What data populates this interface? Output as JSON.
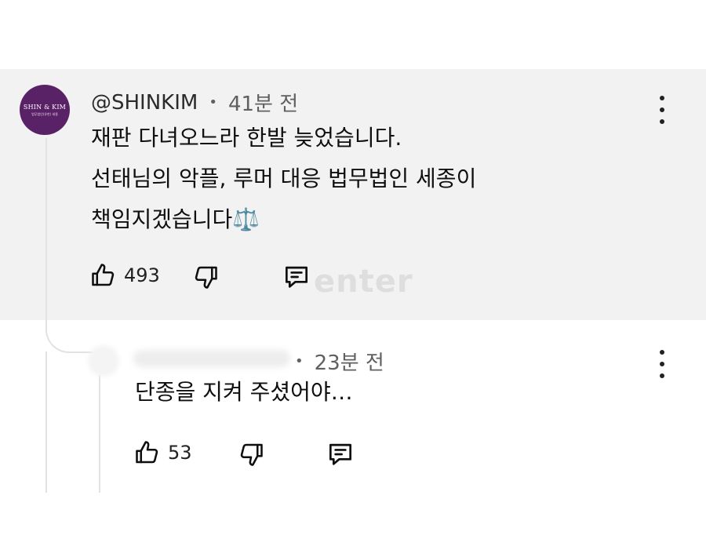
{
  "comment": {
    "handle": "@SHINKIM",
    "separator": "•",
    "time": "41분 전",
    "lines": [
      "재판 다녀오느라 한발 늦었습니다.",
      "선태님의 악플, 루머 대응 법무법인 세종이",
      "책임지겠습니다⚖️"
    ],
    "avatar": {
      "logo_text": "SHIN & KIM",
      "logo_sub": "법무법인(유한) 세종",
      "color": "#5a2266"
    },
    "likes": "493",
    "icons": [
      "thumbs-up-icon",
      "thumbs-down-icon",
      "reply-icon",
      "more-vertical-icon"
    ]
  },
  "reply": {
    "separator": "•",
    "time": "23분 전",
    "text": "단종을 지켜 주셨어야…",
    "likes": "53",
    "icons": [
      "thumbs-up-icon",
      "thumbs-down-icon",
      "reply-icon",
      "more-vertical-icon"
    ]
  },
  "watermark": "enter"
}
